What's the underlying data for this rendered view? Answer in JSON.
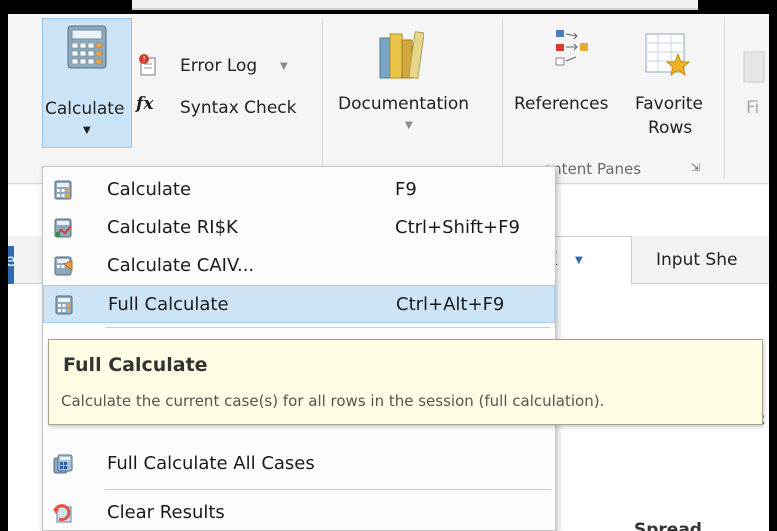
{
  "ribbon": {
    "calculate_label": "Calculate",
    "error_log_label": "Error Log",
    "syntax_check_label": "Syntax Check",
    "documentation_label": "Documentation",
    "references_label": "References",
    "favorite_rows_label_1": "Favorite",
    "favorite_rows_label_2": "Rows",
    "cut_off_label": "Fi",
    "group_label": "ontent Panes"
  },
  "tabs": {
    "sk_tab_label": "$K",
    "input_sheet_label": "Input She",
    "left_edge_letter": "e"
  },
  "menu": {
    "items": [
      {
        "label": "Calculate",
        "shortcut": "F9",
        "icon": "calculator-icon"
      },
      {
        "label": "Calculate RI$K",
        "shortcut": "Ctrl+Shift+F9",
        "icon": "calculate-risk-icon"
      },
      {
        "label": "Calculate CAIV...",
        "shortcut": "",
        "icon": "calculate-caiv-icon"
      },
      {
        "label": "Full Calculate",
        "shortcut": "Ctrl+Alt+F9",
        "icon": "full-calculate-icon"
      },
      {
        "label": "Full Calculate All Cases",
        "shortcut": "",
        "icon": "full-calculate-all-icon"
      },
      {
        "label": "Clear Results",
        "shortcut": "",
        "icon": "clear-results-icon"
      }
    ]
  },
  "tooltip": {
    "title": "Full Calculate",
    "description": "Calculate the current case(s) for all rows in the session (full calculation)."
  },
  "background": {
    "bottom_right_text": "Spread",
    "right_colon": ":"
  },
  "colors": {
    "highlight": "#cde4f7",
    "tooltip_bg": "#fffde3",
    "selected_button": "#cce4f7"
  }
}
